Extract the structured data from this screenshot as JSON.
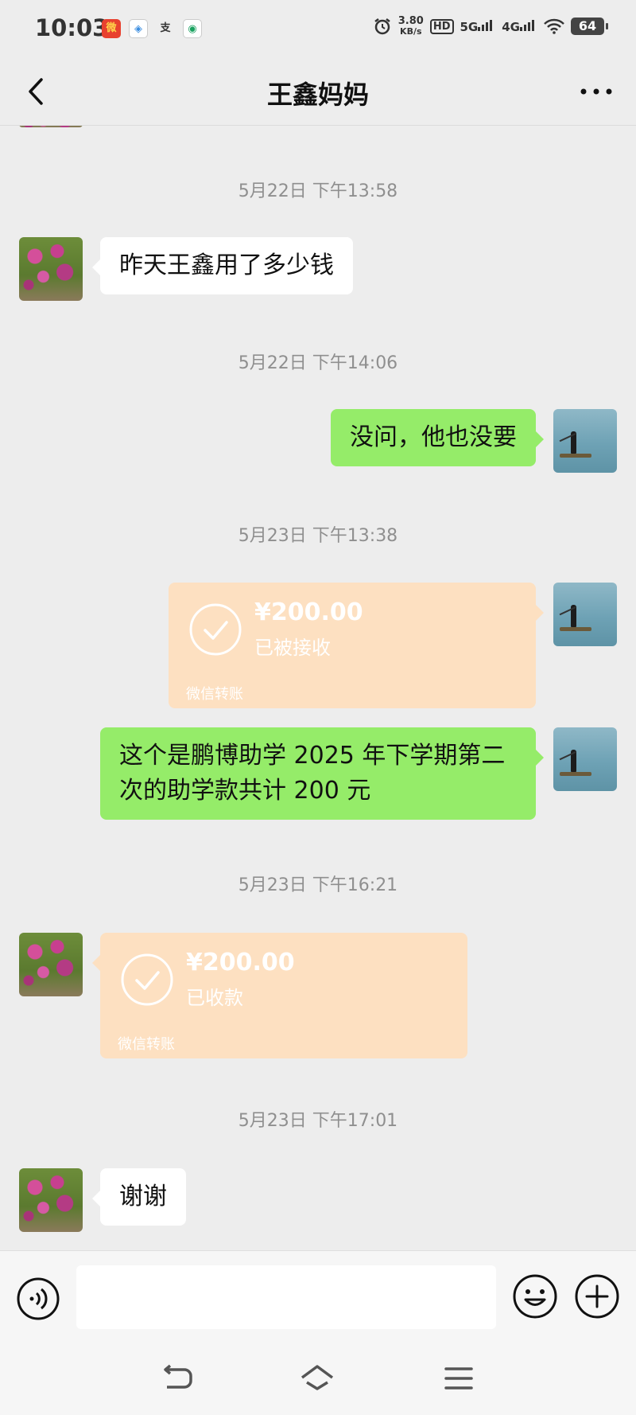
{
  "status_bar": {
    "time": "10:03",
    "app_icons": [
      "weibo-icon",
      "app-icon",
      "alipay-icon",
      "mobile-icon"
    ],
    "net_speed_value": "3.80",
    "net_speed_unit": "KB/s",
    "hd_tag": "HD",
    "signal_5g": "5G",
    "signal_4g": "4G",
    "battery": "64"
  },
  "header": {
    "title": "王鑫妈妈"
  },
  "messages": [
    {
      "time": "5月22日 下午13:58"
    },
    {
      "side": "left",
      "text": "昨天王鑫用了多少钱"
    },
    {
      "time": "5月22日 下午14:06"
    },
    {
      "side": "right",
      "text": "没问，他也没要"
    },
    {
      "time": "5月23日 下午13:38"
    },
    {
      "side": "right",
      "type": "transfer",
      "amount": "¥200.00",
      "status": "已被接收",
      "source": "微信转账"
    },
    {
      "side": "right",
      "text": " 这个是鹏博助学 2025 年下学期第二次的助学款共计 200 元"
    },
    {
      "time": "5月23日 下午16:21"
    },
    {
      "side": "left",
      "type": "transfer",
      "amount": "¥200.00",
      "status": "已收款",
      "source": "微信转账"
    },
    {
      "time": "5月23日 下午17:01"
    },
    {
      "side": "left",
      "text": "谢谢"
    }
  ],
  "input": {
    "value": "",
    "placeholder": ""
  },
  "colors": {
    "background": "#ededed",
    "sent_bubble": "#95ec69",
    "received_bubble": "#ffffff",
    "transfer_card": "#fde0c1"
  }
}
